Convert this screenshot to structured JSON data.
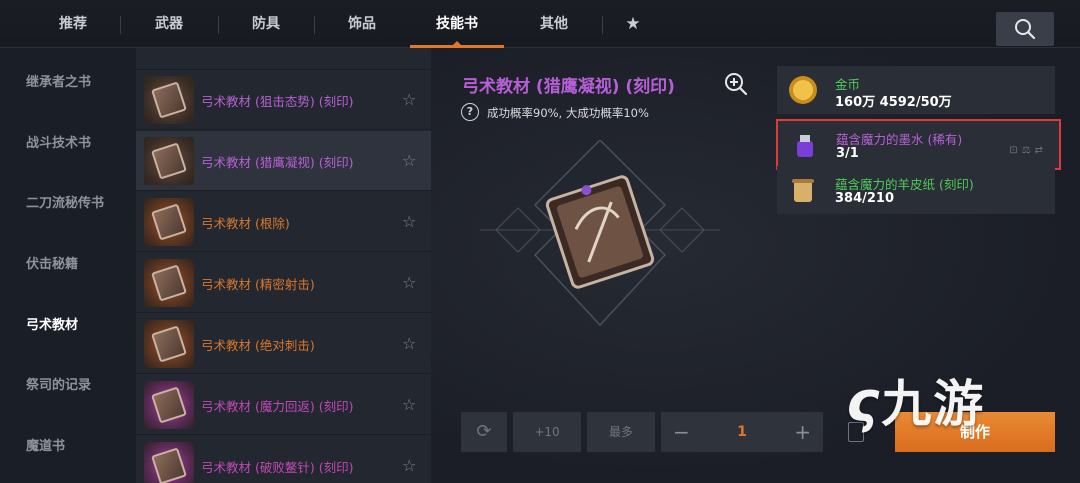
{
  "tabs": [
    {
      "label": "推荐"
    },
    {
      "label": "武器"
    },
    {
      "label": "防具"
    },
    {
      "label": "饰品"
    },
    {
      "label": "技能书"
    },
    {
      "label": "其他"
    }
  ],
  "active_tab": "技能书",
  "favorites_tab_icon": "star-icon",
  "search_icon": "search-icon",
  "categories": [
    {
      "label": "继承者之书"
    },
    {
      "label": "战斗技术书"
    },
    {
      "label": "二刀流秘传书"
    },
    {
      "label": "伏击秘籍"
    },
    {
      "label": "弓术教材"
    },
    {
      "label": "祭司的记录"
    },
    {
      "label": "魔道书"
    }
  ],
  "active_category": "弓术教材",
  "items": [
    {
      "name": "弓术教材 (狙击态势) (刻印)",
      "color": "#b760d6"
    },
    {
      "name": "弓术教材 (猎鹰凝视) (刻印)",
      "color": "#b760d6"
    },
    {
      "name": "弓术教材 (根除)",
      "color": "#d8772d"
    },
    {
      "name": "弓术教材 (精密射击)",
      "color": "#d8772d"
    },
    {
      "name": "弓术教材 (绝对刺击)",
      "color": "#d8772d"
    },
    {
      "name": "弓术教材 (魔力回返) (刻印)",
      "color": "#c148b7"
    },
    {
      "name": "弓术教材 (破败鳌针) (刻印)",
      "color": "#c148b7"
    }
  ],
  "detail": {
    "title": "弓术教材 (猎鹰凝视) (刻印)",
    "rate_text": "成功概率90%, 大成功概率10%",
    "help_glyph": "?"
  },
  "materials": [
    {
      "name": "金币",
      "qty": "160万 4592/50万",
      "icon": "gold-coin-icon"
    },
    {
      "name": "蕴含魔力的墨水 (稀有)",
      "qty": "3/1",
      "icon": "ink-bottle-icon"
    },
    {
      "name": "蕴含魔力的羊皮纸 (刻印)",
      "qty": "384/210",
      "icon": "parchment-icon"
    }
  ],
  "controls": {
    "plus10": "+10",
    "max": "最多",
    "quantity": "1",
    "minus": "−",
    "plus": "+",
    "craft": "制作"
  },
  "watermark": "九游",
  "colors": {
    "accent": "#e0772b",
    "highlight_border": "#e0393a",
    "epic": "#b760d6",
    "legendary": "#d8772d",
    "relic": "#c148b7",
    "material_green": "#4fc95a"
  }
}
